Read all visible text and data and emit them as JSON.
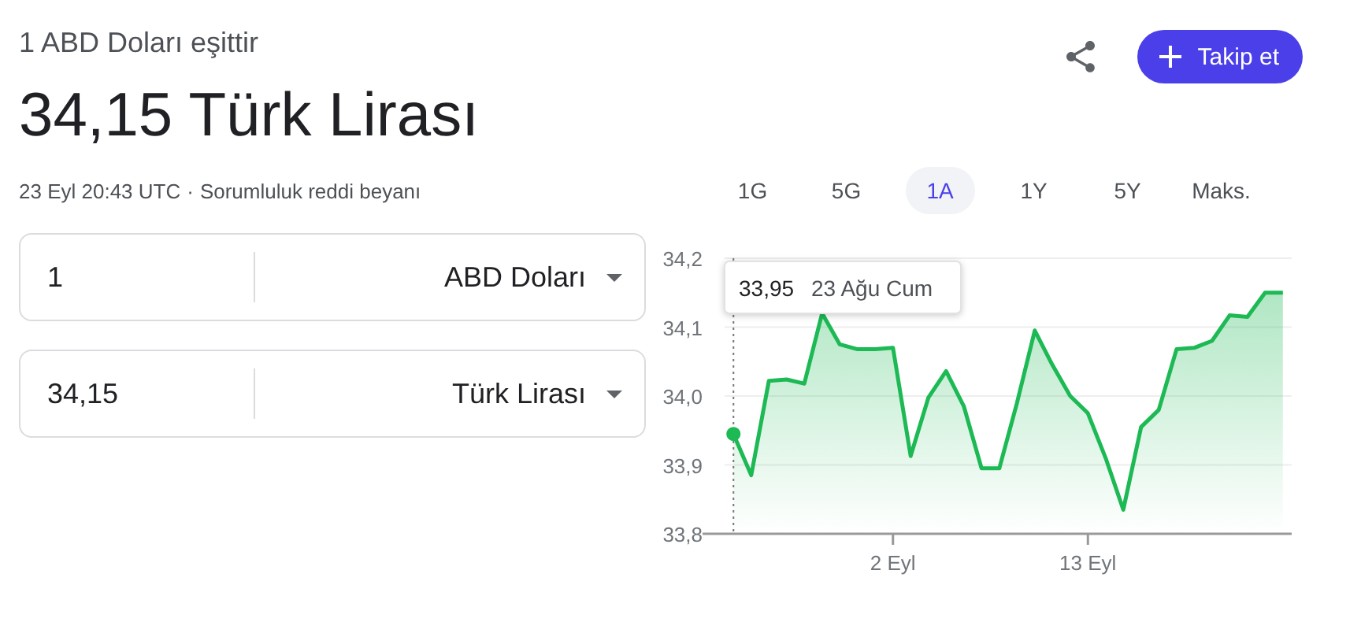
{
  "header": {
    "subtitle": "1 ABD Doları eşittir",
    "result": "34,15 Türk Lirası",
    "timestamp": "23 Eyl 20:43 UTC",
    "separator": "·",
    "disclaimer_link": "Sorumluluk reddi beyanı"
  },
  "converter": [
    {
      "amount": "1",
      "currency": "ABD Doları"
    },
    {
      "amount": "34,15",
      "currency": "Türk Lirası"
    }
  ],
  "follow_button": "Takip et",
  "ranges": [
    {
      "label": "1G",
      "selected": false
    },
    {
      "label": "5G",
      "selected": false
    },
    {
      "label": "1A",
      "selected": true
    },
    {
      "label": "1Y",
      "selected": false
    },
    {
      "label": "5Y",
      "selected": false
    },
    {
      "label": "Maks.",
      "selected": false
    }
  ],
  "chart": {
    "tooltip": {
      "value": "33,95",
      "date": "23 Ağu Cum"
    },
    "chart_data": {
      "type": "area",
      "categories": [
        null,
        null,
        null,
        null,
        null,
        null,
        null,
        null,
        null,
        "2 Eyl",
        null,
        null,
        null,
        null,
        null,
        null,
        null,
        null,
        null,
        null,
        "13 Eyl",
        null,
        null,
        null,
        null,
        null,
        null,
        null,
        null,
        null,
        null,
        null
      ],
      "series": [
        {
          "color": "#1db954",
          "values": [
            33.945,
            33.885,
            34.022,
            34.024,
            34.018,
            34.12,
            34.075,
            34.068,
            34.068,
            34.07,
            33.913,
            33.998,
            34.036,
            33.985,
            33.895,
            33.895,
            33.99,
            34.095,
            34.045,
            34.0,
            33.975,
            33.91,
            33.835,
            33.955,
            33.98,
            34.068,
            34.07,
            34.08,
            34.117,
            34.115,
            34.15,
            34.15
          ]
        }
      ],
      "ylim": [
        33.8,
        34.2
      ],
      "grid": true,
      "yticks": [
        {
          "value": 33.8,
          "label": "33,8"
        },
        {
          "value": 33.9,
          "label": "33,9"
        },
        {
          "value": 34.0,
          "label": "34,0"
        },
        {
          "value": 34.1,
          "label": "34,1"
        },
        {
          "value": 34.2,
          "label": "34,2"
        }
      ]
    }
  }
}
